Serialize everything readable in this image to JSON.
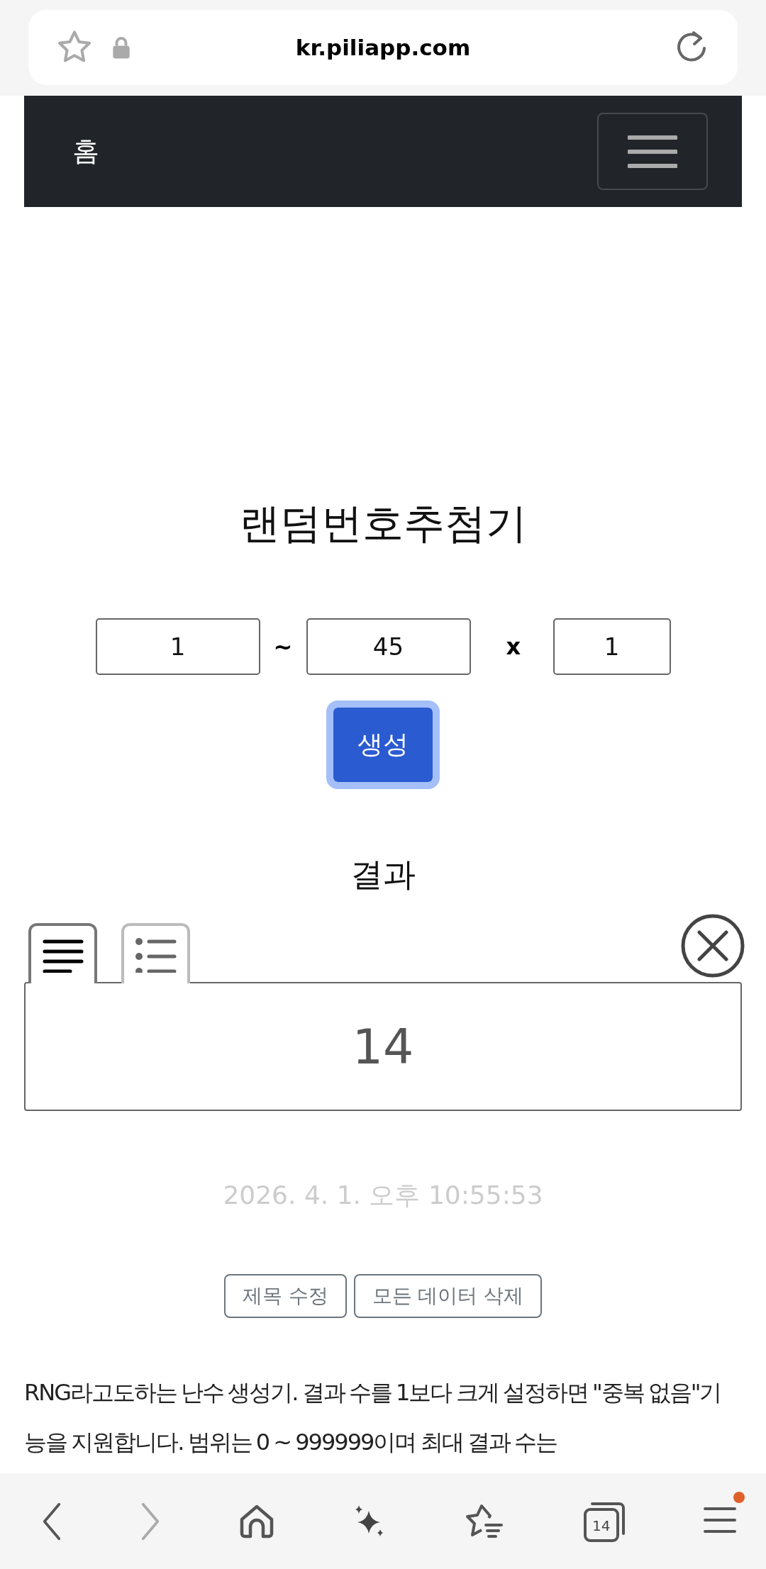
{
  "address_bar": {
    "url": "kr.piliapp.com"
  },
  "navbar": {
    "brand": "홈"
  },
  "title": "랜덤번호추첨기",
  "range": {
    "min": "1",
    "separator": "~",
    "max": "45",
    "times_sign": "x",
    "count": "1"
  },
  "generate_button": "생성",
  "result": {
    "heading": "결과",
    "views": [
      {
        "kind": "text",
        "selected": true
      },
      {
        "kind": "list",
        "selected": false
      }
    ],
    "value": "14",
    "timestamp": "2026. 4. 1. 오후 10:55:53"
  },
  "actions": [
    "제목 수정",
    "모든 데이터 삭제"
  ],
  "description": "RNG라고도하는 난수 생성기. 결과 수를 1보다 크게 설정하면 \"중복 없음\"기능을 지원합니다. 범위는 0 ~ 999999이며 최대 결과 수는",
  "bottom_bar": {
    "buttons": [
      {
        "kind": "back",
        "disabled": false
      },
      {
        "kind": "forward",
        "disabled": true
      },
      {
        "kind": "home"
      },
      {
        "kind": "ai"
      },
      {
        "kind": "bookmarks"
      },
      {
        "kind": "tabs",
        "count": "14"
      },
      {
        "kind": "menu",
        "badge": true
      }
    ]
  }
}
